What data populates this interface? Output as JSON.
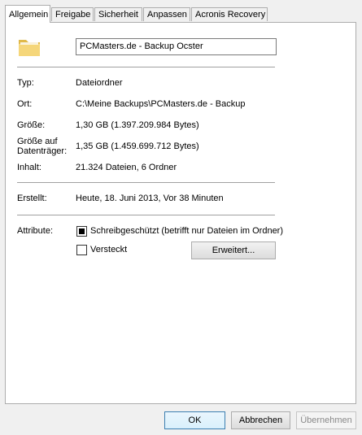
{
  "tabs": [
    "Allgemein",
    "Freigabe",
    "Sicherheit",
    "Anpassen",
    "Acronis Recovery"
  ],
  "active_tab": "Allgemein",
  "name_field": "PCMasters.de - Backup Ocster",
  "icon": "folder-icon",
  "properties": {
    "type_label": "Typ:",
    "type_value": "Dateiordner",
    "location_label": "Ort:",
    "location_value": "C:\\Meine Backups\\PCMasters.de - Backup",
    "size_label": "Größe:",
    "size_value": "1,30 GB (1.397.209.984 Bytes)",
    "size_on_disk_label_line1": "Größe auf",
    "size_on_disk_label_line2": "Datenträger:",
    "size_on_disk_value": "1,35 GB (1.459.699.712 Bytes)",
    "contents_label": "Inhalt:",
    "contents_value": "21.324 Dateien, 6 Ordner",
    "created_label": "Erstellt:",
    "created_value": "Heute, 18. Juni 2013, Vor 38 Minuten"
  },
  "attributes": {
    "label": "Attribute:",
    "readonly_label": "Schreibgeschützt (betrifft nur Dateien im Ordner)",
    "readonly_state": "indeterminate",
    "hidden_label": "Versteckt",
    "hidden_checked": false,
    "advanced_button": "Erweitert..."
  },
  "buttons": {
    "ok": "OK",
    "cancel": "Abbrechen",
    "apply": "Übernehmen"
  }
}
